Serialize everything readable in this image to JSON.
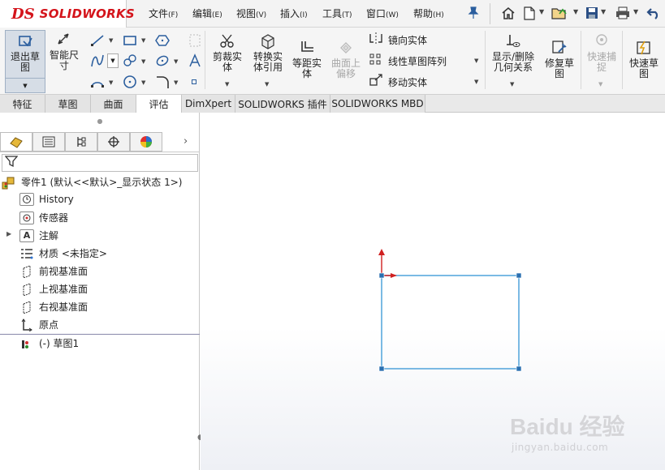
{
  "app": {
    "logo_ds": "DS",
    "logo_text": "SOLIDWORKS"
  },
  "menu": [
    {
      "label": "文件",
      "key": "(F)"
    },
    {
      "label": "编辑",
      "key": "(E)"
    },
    {
      "label": "视图",
      "key": "(V)"
    },
    {
      "label": "插入",
      "key": "(I)"
    },
    {
      "label": "工具",
      "key": "(T)"
    },
    {
      "label": "窗口",
      "key": "(W)"
    },
    {
      "label": "帮助",
      "key": "(H)"
    }
  ],
  "quick_access": [
    "pin-icon",
    "home-icon",
    "new-document-icon",
    "open-icon",
    "save-icon",
    "print-icon",
    "undo-icon"
  ],
  "ribbon": {
    "exit_sketch": "退出草图",
    "smart_dim": "智能尺寸",
    "trim": "剪裁实体",
    "convert": "转换实体引用",
    "offset": "等距实体",
    "surface_offset": "曲面上偏移",
    "mirror": "镜向实体",
    "linear_pattern": "线性草图阵列",
    "move": "移动实体",
    "display_relations": "显示/删除几何关系",
    "repair": "修复草图",
    "quick_snap": "快速捕捉",
    "rapid_sketch": "快速草图"
  },
  "tabs": [
    "特征",
    "草图",
    "曲面",
    "评估",
    "DimXpert",
    "SOLIDWORKS 插件",
    "SOLIDWORKS MBD"
  ],
  "active_tab": "评估",
  "tree": {
    "part": "零件1  (默认<<默认>_显示状态 1>)",
    "items": [
      "History",
      "传感器",
      "注解",
      "材质 <未指定>",
      "前视基准面",
      "上视基准面",
      "右视基准面",
      "原点",
      "(-) 草图1"
    ]
  },
  "watermark": {
    "brand": "Baidu 经验",
    "url": "jingyan.baidu.com"
  },
  "colors": {
    "accent": "#d4141b",
    "sketch": "#5aa9dd",
    "axis_red": "#d02020"
  }
}
